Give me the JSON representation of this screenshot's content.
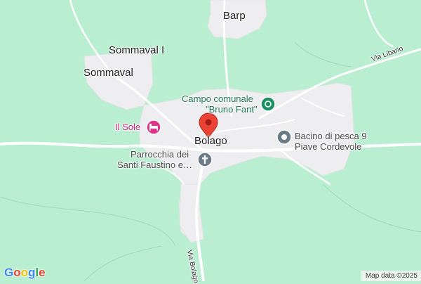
{
  "map": {
    "labels": {
      "barp": "Barp",
      "sommaval_i": "Sommaval I",
      "sommaval": "Sommaval",
      "campo_line1": "Campo comunale",
      "campo_line2": "\"Bruno Fant\"",
      "il_sole": "Il Sole",
      "bolago": "Bolago",
      "bacino_line1": "Bacino di pesca 9",
      "bacino_line2": "Piave Cordevole",
      "parrocchia_line1": "Parrocchia dei",
      "parrocchia_line2": "Santi Faustino e…",
      "via_libano": "Via Libano",
      "via_bolago": "Via Bolago"
    },
    "icons": {
      "campo": "sports-field-icon",
      "il_sole": "hotel-bed-icon",
      "bacino": "point-of-interest-icon",
      "parrocchia": "church-cross-icon",
      "marker": "location-pin-icon"
    },
    "colors": {
      "terrain": "#b9efd0",
      "settlement": "#eeeef0",
      "road": "#ffffff",
      "marker": "#ea4335",
      "poi_green": "#1e7a55",
      "poi_pink": "#d11f7b",
      "poi_gray": "#6b7b88"
    }
  },
  "branding": {
    "logo_letters": [
      "G",
      "o",
      "o",
      "g",
      "l",
      "e"
    ],
    "logo_colors": [
      "#4285f4",
      "#ea4335",
      "#fbbc05",
      "#4285f4",
      "#34a853",
      "#ea4335"
    ]
  },
  "attribution": "Map data ©2025"
}
